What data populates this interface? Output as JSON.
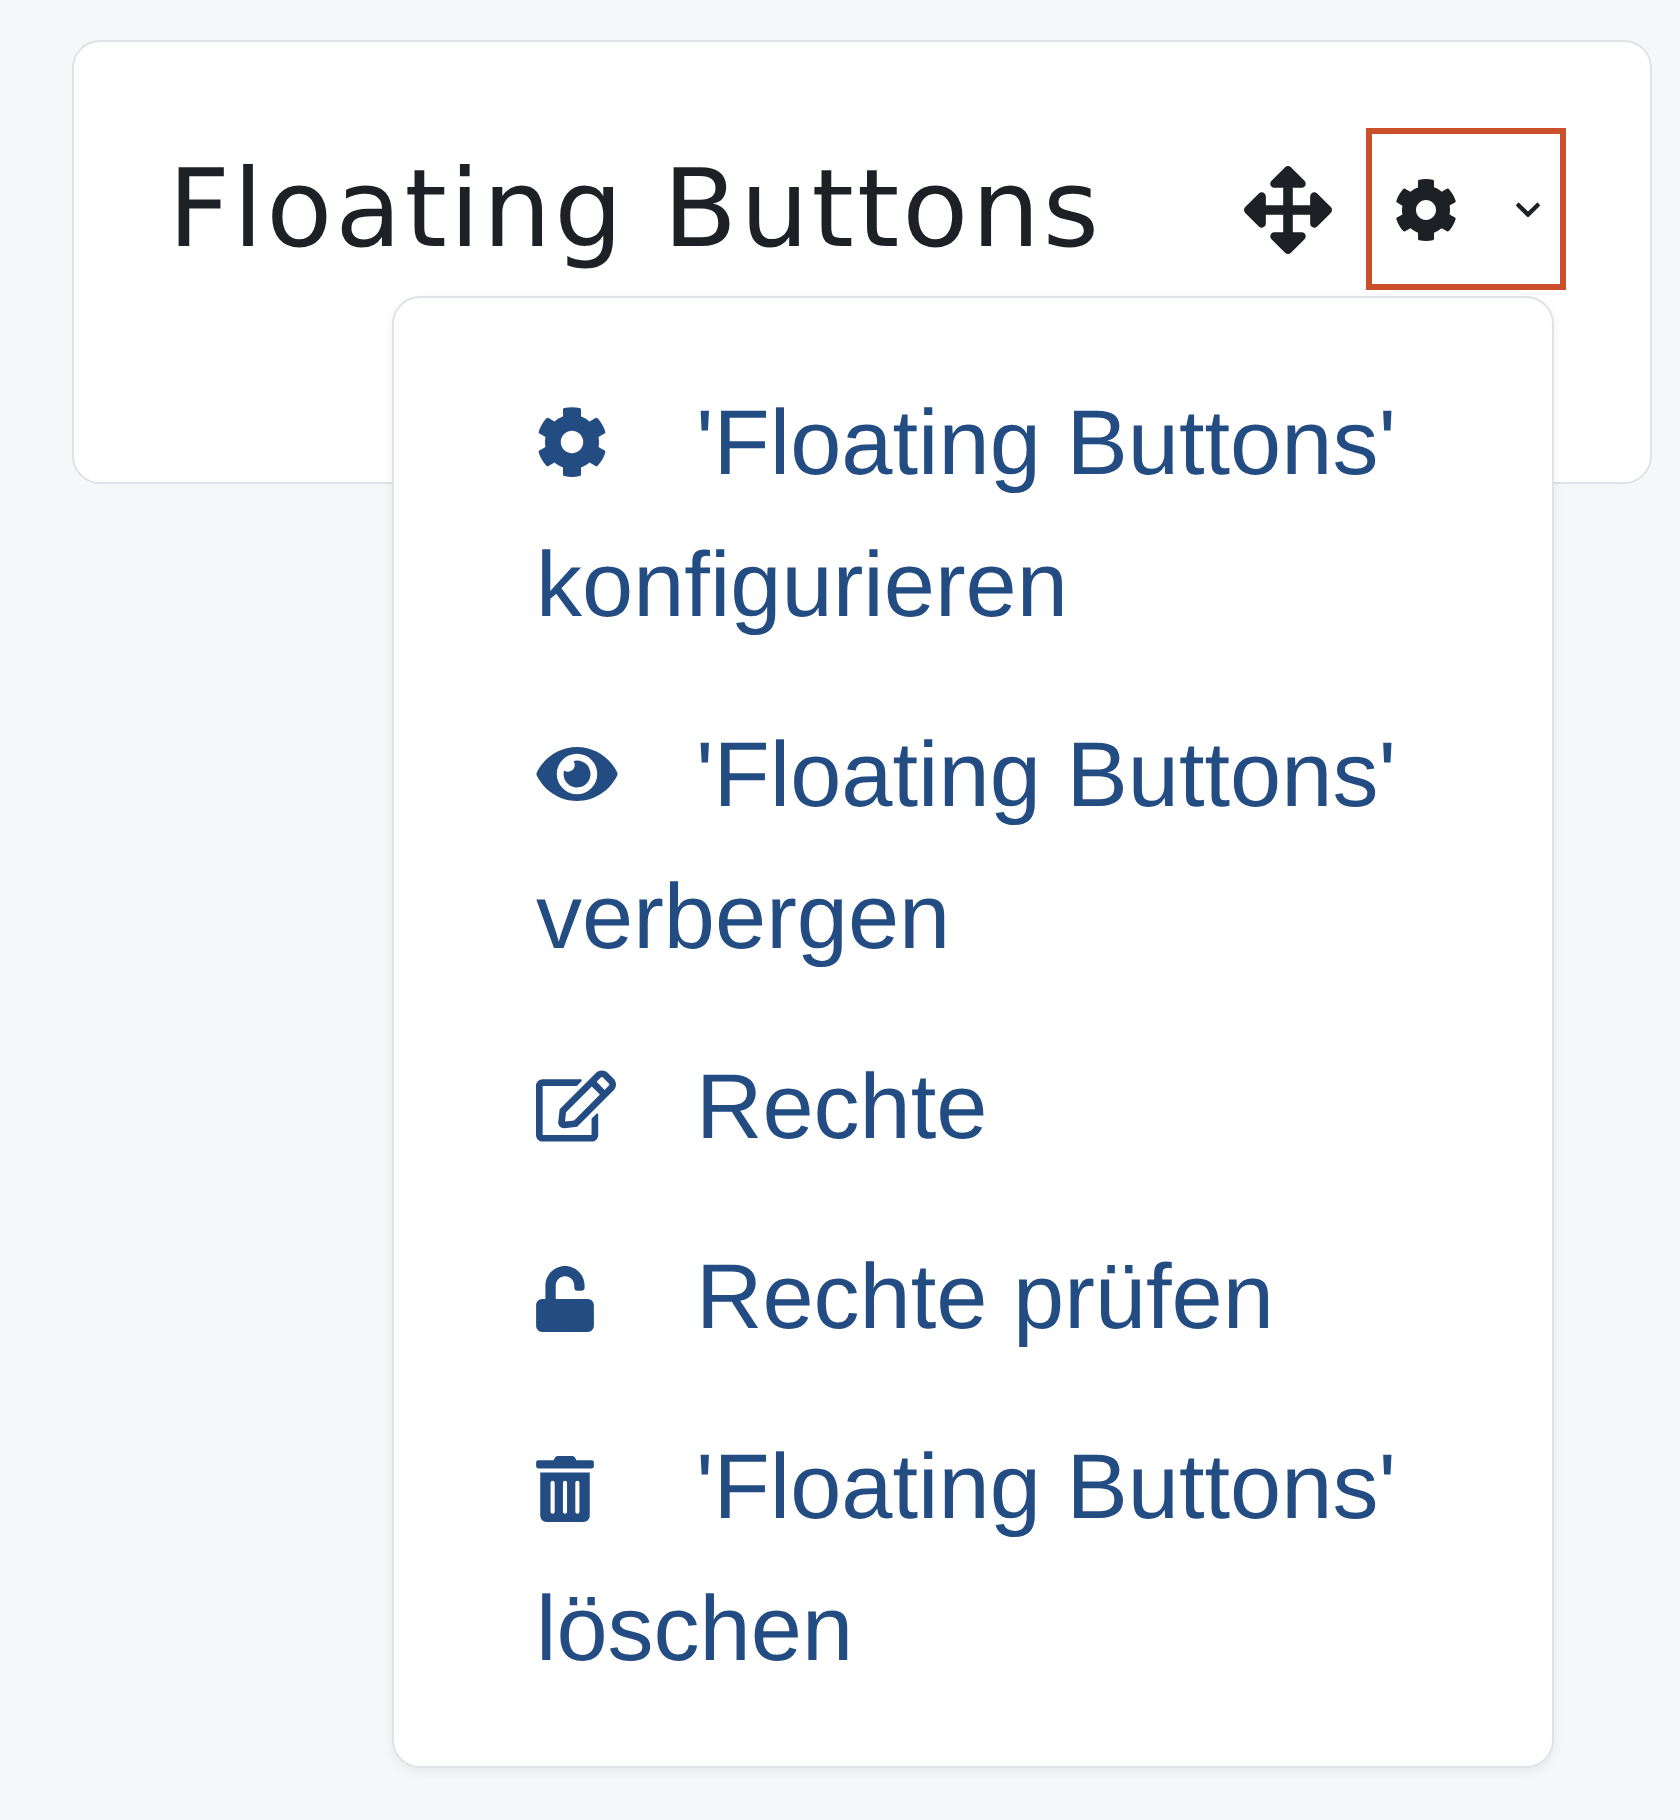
{
  "block": {
    "title": "Floating Buttons",
    "actions_button": {
      "focused": true,
      "expanded": true
    }
  },
  "menu": {
    "items": [
      {
        "kind": "configure",
        "label": "'Floating Buttons' konfigurieren"
      },
      {
        "kind": "hide",
        "label": "'Floating Buttons' verbergen"
      },
      {
        "kind": "permissions",
        "label": "Rechte"
      },
      {
        "kind": "check_permissions",
        "label": "Rechte prüfen"
      },
      {
        "kind": "delete",
        "label": "'Floating Buttons' löschen"
      }
    ]
  }
}
